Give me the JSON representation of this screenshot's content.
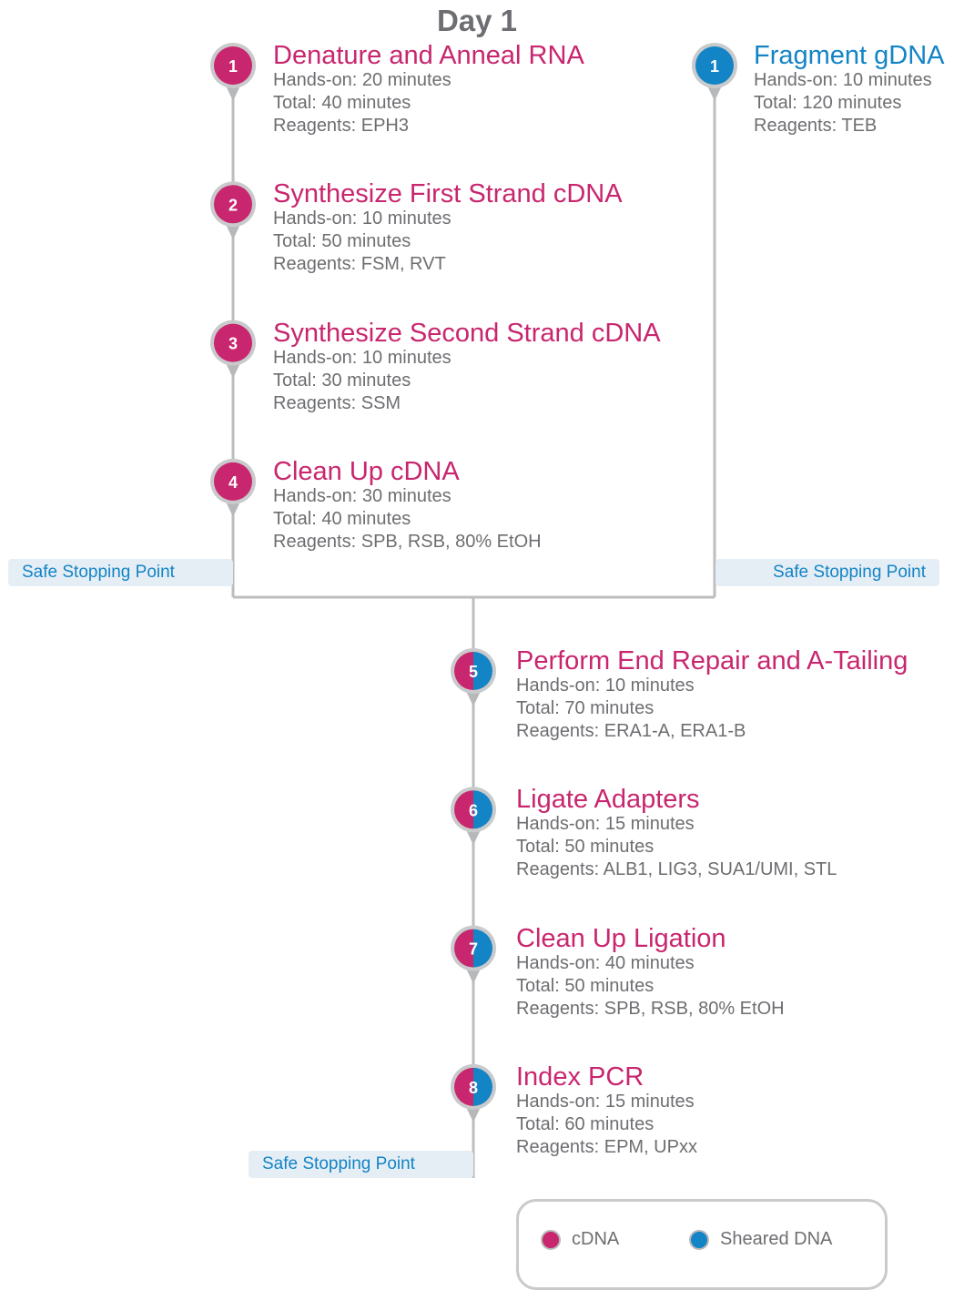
{
  "title": "Day 1",
  "colors": {
    "cdna": "#c8266e",
    "dna": "#1384c6",
    "text": "#6d6e71",
    "line": "#bcbdbf",
    "safe_bg": "#e6eef5"
  },
  "branch_cdna": [
    {
      "number": "1",
      "title": "Denature and Anneal RNA",
      "hands_on": "Hands-on: 20 minutes",
      "total": "Total: 40 minutes",
      "reagents": "Reagents: EPH3"
    },
    {
      "number": "2",
      "title": "Synthesize First Strand cDNA",
      "hands_on": "Hands-on: 10 minutes",
      "total": "Total: 50 minutes",
      "reagents": "Reagents: FSM, RVT"
    },
    {
      "number": "3",
      "title": "Synthesize Second Strand cDNA",
      "hands_on": "Hands-on: 10 minutes",
      "total": "Total: 30 minutes",
      "reagents": "Reagents: SSM"
    },
    {
      "number": "4",
      "title": "Clean Up cDNA",
      "hands_on": "Hands-on: 30 minutes",
      "total": "Total: 40 minutes",
      "reagents": "Reagents: SPB, RSB, 80% EtOH"
    }
  ],
  "branch_dna": [
    {
      "number": "1",
      "title": "Fragment gDNA",
      "hands_on": "Hands-on: 10 minutes",
      "total": "Total: 120 minutes",
      "reagents": "Reagents: TEB"
    }
  ],
  "merged_steps": [
    {
      "number": "5",
      "title": "Perform End Repair and A-Tailing",
      "hands_on": "Hands-on: 10 minutes",
      "total": "Total: 70 minutes",
      "reagents": "Reagents: ERA1-A, ERA1-B"
    },
    {
      "number": "6",
      "title": "Ligate Adapters",
      "hands_on": "Hands-on: 15 minutes",
      "total": "Total: 50 minutes",
      "reagents": "Reagents: ALB1, LIG3, SUA1/UMI, STL"
    },
    {
      "number": "7",
      "title": "Clean Up Ligation",
      "hands_on": "Hands-on: 40 minutes",
      "total": "Total: 50 minutes",
      "reagents": "Reagents: SPB, RSB, 80% EtOH"
    },
    {
      "number": "8",
      "title": "Index PCR",
      "hands_on": "Hands-on: 15 minutes",
      "total": "Total: 60 minutes",
      "reagents": "Reagents: EPM, UPxx"
    }
  ],
  "safe_stop": {
    "left": "Safe Stopping Point",
    "right": "Safe Stopping Point",
    "bottom": "Safe Stopping Point"
  },
  "legend": {
    "cdna": "cDNA",
    "dna": "Sheared DNA"
  }
}
